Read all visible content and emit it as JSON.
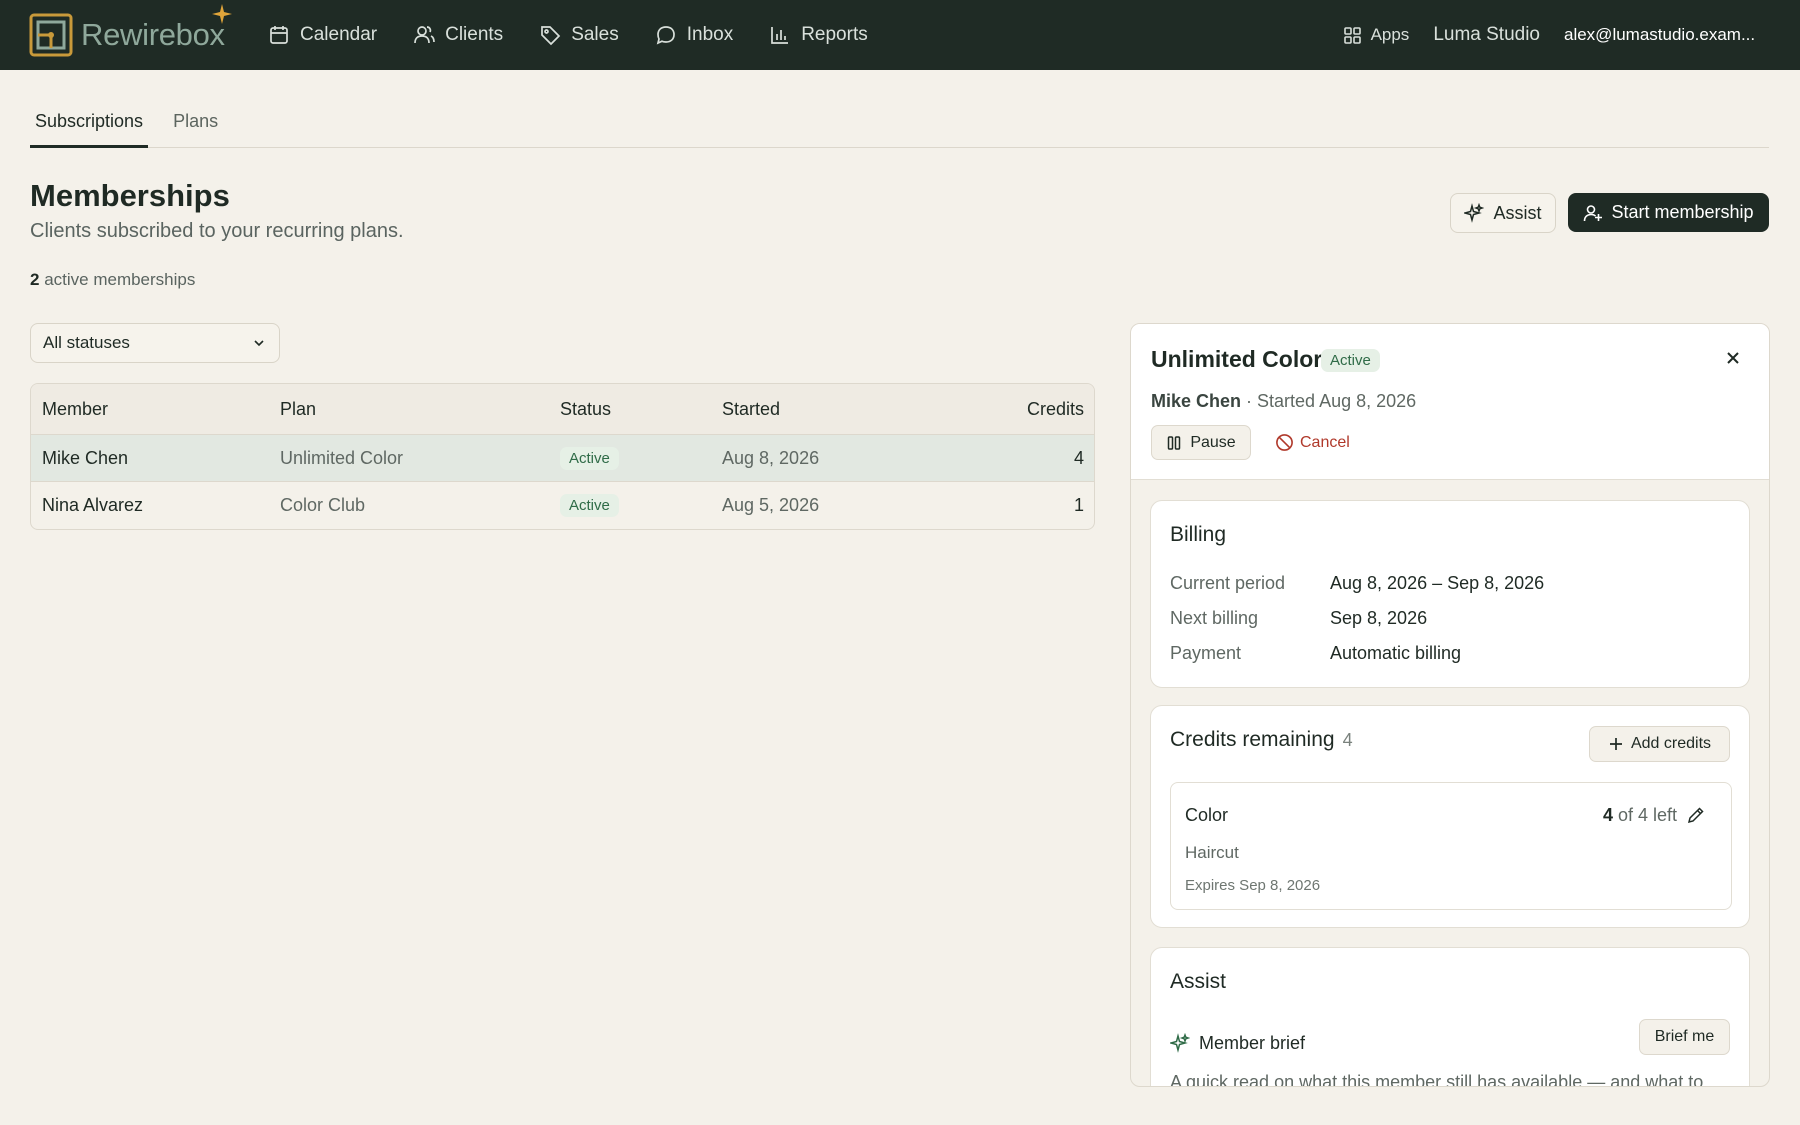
{
  "app": {
    "name": "Rewirebox",
    "nav": [
      {
        "label": "Calendar",
        "icon": "calendar-icon"
      },
      {
        "label": "Clients",
        "icon": "users-icon"
      },
      {
        "label": "Sales",
        "icon": "tag-icon"
      },
      {
        "label": "Inbox",
        "icon": "chat-icon"
      },
      {
        "label": "Reports",
        "icon": "bar-chart-icon"
      }
    ],
    "apps_label": "Apps",
    "studio": "Luma Studio",
    "account": "alex@lumastudio.exam..."
  },
  "subtabs": [
    "Subscriptions",
    "Plans"
  ],
  "page": {
    "title": "Memberships",
    "subtitle": "Clients subscribed to your recurring plans.",
    "count": "2",
    "count_suffix": " active memberships",
    "assist_label": "Assist",
    "start_label": "Start membership",
    "filter_value": "All statuses"
  },
  "table": {
    "columns": [
      "Member",
      "Plan",
      "Status",
      "Started",
      "Credits"
    ],
    "rows": [
      {
        "member": "Mike Chen",
        "plan": "Unlimited Color",
        "status": "Active",
        "started": "Aug 8, 2026",
        "credits": "4"
      },
      {
        "member": "Nina Alvarez",
        "plan": "Color Club",
        "status": "Active",
        "started": "Aug 5, 2026",
        "credits": "1"
      }
    ]
  },
  "detail": {
    "title": "Unlimited Color",
    "status": "Active",
    "member": "Mike Chen",
    "started": " · Started Aug 8, 2026",
    "pause_label": "Pause",
    "cancel_label": "Cancel",
    "billing": {
      "title": "Billing",
      "rows": [
        {
          "label": "Current period",
          "value": "Aug 8, 2026 – Sep 8, 2026"
        },
        {
          "label": "Next billing",
          "value": "Sep 8, 2026"
        },
        {
          "label": "Payment",
          "value": "Automatic billing"
        }
      ]
    },
    "credits": {
      "title": "Credits remaining",
      "count": "4",
      "add_label": "Add credits",
      "item": {
        "name": "Color",
        "left_num": "4",
        "left_rest": " of 4 left",
        "service": "Haircut",
        "expires": "Expires Sep 8, 2026"
      }
    },
    "assist": {
      "title": "Assist",
      "brief_label": "Member brief",
      "brief_button": "Brief me",
      "brief_text": "A quick read on what this member still has available — and what to"
    }
  },
  "colors": {
    "topbar": "#1f2b25",
    "background": "#f4f1ea",
    "accent_gold": "#e0a53a",
    "active_green": "#2f6b47",
    "cancel_red": "#b0392b"
  }
}
